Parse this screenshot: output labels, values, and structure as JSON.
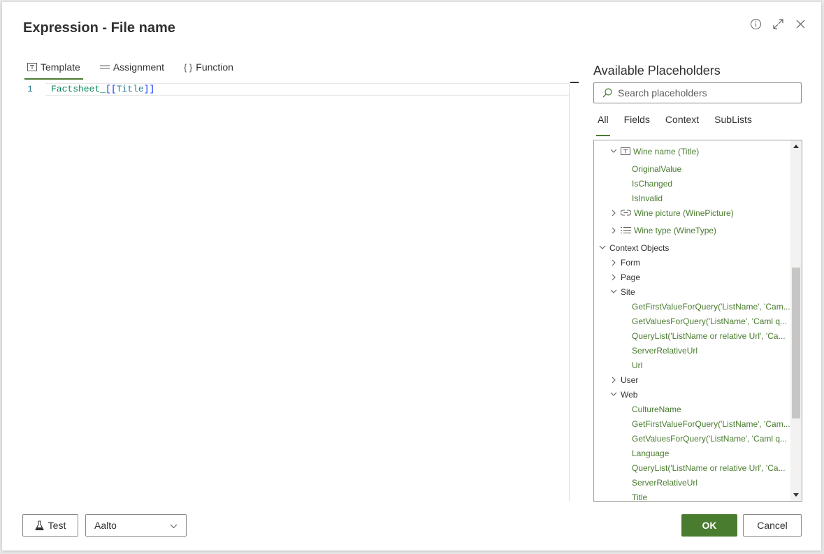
{
  "dialog": {
    "title": "Expression - File name",
    "header_icons": [
      "info-icon",
      "expand-icon",
      "close-icon"
    ]
  },
  "editor_tabs": [
    {
      "label": "Template",
      "icon": "template-icon",
      "active": true
    },
    {
      "label": "Assignment",
      "icon": "assignment-icon",
      "active": false
    },
    {
      "label": "Function",
      "icon": "function-icon",
      "active": false
    }
  ],
  "code": {
    "line_number": "1",
    "prefix": "Factsheet_",
    "open": "[[",
    "field": "Title",
    "close": "]]"
  },
  "placeholders": {
    "title": "Available Placeholders",
    "search_placeholder": "Search placeholders",
    "tabs": [
      {
        "label": "All",
        "active": true
      },
      {
        "label": "Fields",
        "active": false
      },
      {
        "label": "Context",
        "active": false
      },
      {
        "label": "SubLists",
        "active": false
      }
    ],
    "tree": [
      {
        "label": "Wine name (Title)",
        "chevron": "down",
        "icon": "text-field-icon",
        "kind": "field"
      },
      {
        "label": "OriginalValue",
        "kind": "leaf"
      },
      {
        "label": "IsChanged",
        "kind": "leaf"
      },
      {
        "label": "IsInvalid",
        "kind": "leaf"
      },
      {
        "label": "Wine picture (WinePicture)",
        "chevron": "right",
        "icon": "link-icon",
        "kind": "field"
      },
      {
        "label": "Wine type (WineType)",
        "chevron": "right",
        "icon": "list-icon",
        "kind": "field"
      },
      {
        "label": "Context Objects",
        "chevron": "down",
        "kind": "group"
      },
      {
        "label": "Form",
        "chevron": "right",
        "kind": "node"
      },
      {
        "label": "Page",
        "chevron": "right",
        "kind": "node"
      },
      {
        "label": "Site",
        "chevron": "down",
        "kind": "node"
      },
      {
        "label": "GetFirstValueForQuery('ListName', 'Cam...",
        "kind": "leaf"
      },
      {
        "label": "GetValuesForQuery('ListName', 'Caml q...",
        "kind": "leaf"
      },
      {
        "label": "QueryList('ListName or relative Url', 'Ca...",
        "kind": "leaf"
      },
      {
        "label": "ServerRelativeUrl",
        "kind": "leaf"
      },
      {
        "label": "Url",
        "kind": "leaf"
      },
      {
        "label": "User",
        "chevron": "right",
        "kind": "node"
      },
      {
        "label": "Web",
        "chevron": "down",
        "kind": "node"
      },
      {
        "label": "CultureName",
        "kind": "leaf"
      },
      {
        "label": "GetFirstValueForQuery('ListName', 'Cam...",
        "kind": "leaf"
      },
      {
        "label": "GetValuesForQuery('ListName', 'Caml q...",
        "kind": "leaf"
      },
      {
        "label": "Language",
        "kind": "leaf"
      },
      {
        "label": "QueryList('ListName or relative Url', 'Ca...",
        "kind": "leaf"
      },
      {
        "label": "ServerRelativeUrl",
        "kind": "leaf"
      },
      {
        "label": "Title",
        "kind": "leaf"
      }
    ],
    "scroll_position": 0.62
  },
  "footer": {
    "test_label": "Test",
    "select_value": "Aalto",
    "ok_label": "OK",
    "cancel_label": "Cancel"
  },
  "colors": {
    "accent": "#4a7c2f",
    "link_text": "#4a7c2f"
  }
}
